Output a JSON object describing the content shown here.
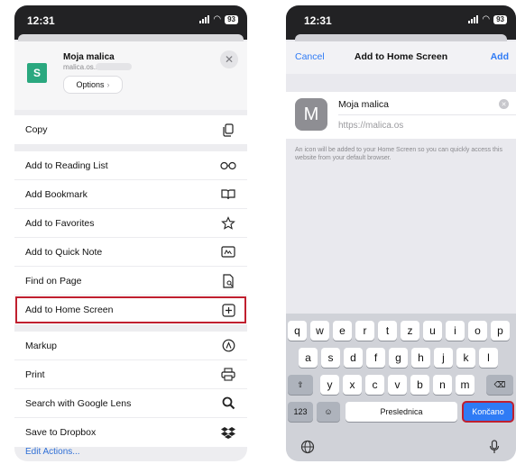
{
  "left": {
    "status": {
      "time": "12:31",
      "battery": "93"
    },
    "site": {
      "logo_letter": "S",
      "title": "Moja malica",
      "url": "malica.os.si"
    },
    "options_label": "Options",
    "options_chevron": "›",
    "close_glyph": "✕",
    "groups": [
      [
        {
          "label": "Copy",
          "icon": "copy-icon"
        }
      ],
      [
        {
          "label": "Add to Reading List",
          "icon": "glasses-icon"
        },
        {
          "label": "Add Bookmark",
          "icon": "book-icon"
        },
        {
          "label": "Add to Favorites",
          "icon": "star-icon"
        },
        {
          "label": "Add to Quick Note",
          "icon": "quick-note-icon"
        },
        {
          "label": "Find on Page",
          "icon": "find-on-page-icon"
        },
        {
          "label": "Add to Home Screen",
          "icon": "plus-square-icon",
          "highlight": true
        }
      ],
      [
        {
          "label": "Markup",
          "icon": "markup-icon"
        },
        {
          "label": "Print",
          "icon": "printer-icon"
        },
        {
          "label": "Search with Google Lens",
          "icon": "search-icon"
        },
        {
          "label": "Save to Dropbox",
          "icon": "dropbox-icon"
        }
      ]
    ],
    "edit_actions": "Edit Actions..."
  },
  "right": {
    "status": {
      "time": "12:31",
      "battery": "93"
    },
    "nav": {
      "cancel": "Cancel",
      "title": "Add to Home Screen",
      "add": "Add"
    },
    "form": {
      "icon_letter": "M",
      "name_value": "Moja malica",
      "url_value": "https://malica.os",
      "clear_glyph": "✕"
    },
    "hint": "An icon will be added to your Home Screen so you can quickly access this website from your default browser.",
    "keyboard": {
      "row1": [
        "q",
        "w",
        "e",
        "r",
        "t",
        "z",
        "u",
        "i",
        "o",
        "p"
      ],
      "row2": [
        "a",
        "s",
        "d",
        "f",
        "g",
        "h",
        "j",
        "k",
        "l"
      ],
      "row3": [
        "y",
        "x",
        "c",
        "v",
        "b",
        "n",
        "m"
      ],
      "numbers_key": "123",
      "space_key": "Preslednica",
      "done_key": "Končano",
      "shift_glyph": "⇧",
      "backspace_glyph": "⌫",
      "emoji_glyph": "☺"
    }
  },
  "colors": {
    "accent": "#2f7bf5",
    "highlight": "#c0202f",
    "site_logo": "#2aa87f"
  }
}
